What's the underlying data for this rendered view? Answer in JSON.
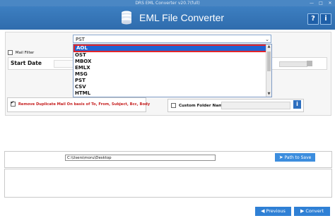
{
  "window": {
    "title": "DRS EML Converter v20.7(full)",
    "controls": [
      "—",
      "□",
      "✕"
    ]
  },
  "header": {
    "title": "EML File Converter",
    "help_label": "?",
    "info_label": "i"
  },
  "format": {
    "selected": "PST",
    "options": [
      "AOL",
      "OST",
      "MBOX",
      "EMLX",
      "MSG",
      "PST",
      "CSV",
      "HTML"
    ],
    "highlighted": "AOL"
  },
  "filters": {
    "mail_filter_label": "Mail Filter",
    "start_date_label": "Start Date"
  },
  "options": {
    "remove_duplicate_label": "Remove Duplicate Mail On basis of To, From, Subject, Bcc, Body",
    "custom_folder_label": "Custom Folder Name"
  },
  "path": {
    "value": "C:\\Users\\moru\\Desktop",
    "button_label": "Path to Save"
  },
  "nav": {
    "previous_label": "Previous",
    "convert_label": "Convert"
  }
}
